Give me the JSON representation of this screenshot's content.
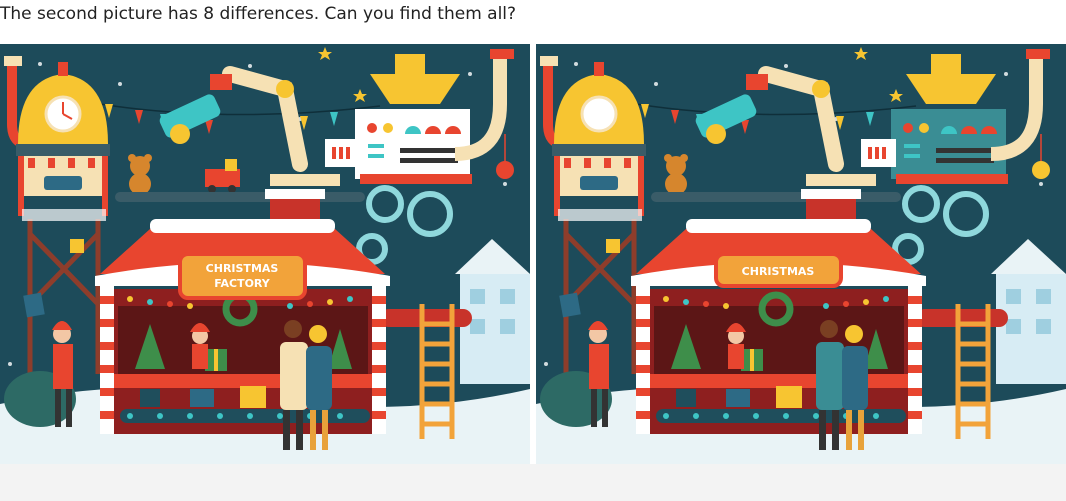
{
  "question": "The second picture has 8 differences. Can you find them all?",
  "pictures": {
    "left": {
      "sign_line1": "CHRISTMAS",
      "sign_line2": "FACTORY",
      "clock_hands_visible": true
    },
    "right": {
      "sign_line1": "CHRISTMAS",
      "sign_line2": "",
      "clock_hands_visible": false
    }
  },
  "colors": {
    "sky": "#1d4b5a",
    "snow": "#e9f3f6",
    "roof": "#e8452f",
    "sign": "#f2a33a",
    "accent_yellow": "#f7c531",
    "cream": "#f6e1b4"
  }
}
